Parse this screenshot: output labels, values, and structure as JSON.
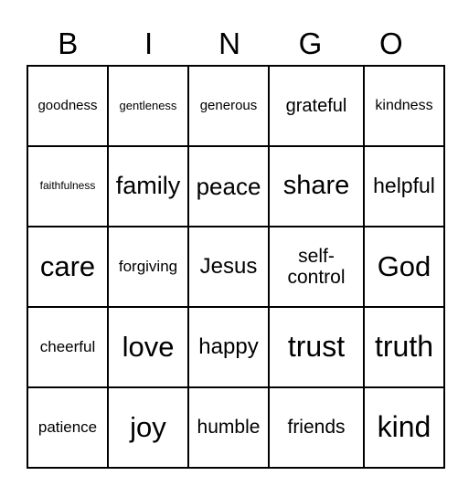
{
  "header": [
    "B",
    "I",
    "N",
    "G",
    "O"
  ],
  "cells": [
    [
      "goodness",
      "gentleness",
      "generous",
      "grateful",
      "kindness"
    ],
    [
      "faithfulness",
      "family",
      "peace",
      "share",
      "helpful"
    ],
    [
      "care",
      "forgiving",
      "Jesus",
      "self-control",
      "God"
    ],
    [
      "cheerful",
      "love",
      "happy",
      "trust",
      "truth"
    ],
    [
      "patience",
      "joy",
      "humble",
      "friends",
      "kind"
    ]
  ]
}
